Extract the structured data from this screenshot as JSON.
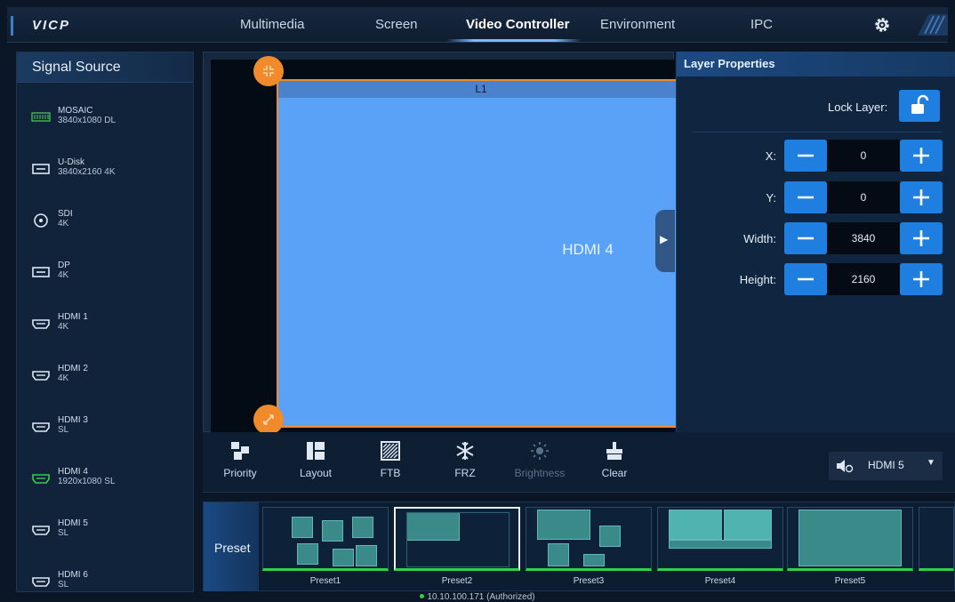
{
  "app": {
    "logo": "VICP"
  },
  "nav": {
    "tabs": [
      {
        "label": "Multimedia"
      },
      {
        "label": "Screen"
      },
      {
        "label": "Video Controller",
        "active": true
      },
      {
        "label": "Environment"
      },
      {
        "label": "IPC"
      }
    ]
  },
  "signal_source": {
    "title": "Signal Source",
    "items": [
      {
        "name": "MOSAIC",
        "res": "3840x1080 DL",
        "icon": "mosaic-icon",
        "active": false
      },
      {
        "name": "U-Disk",
        "res": "3840x2160 4K",
        "icon": "usb-disk-icon",
        "active": false
      },
      {
        "name": "SDI",
        "res": "4K",
        "icon": "sdi-icon",
        "active": false
      },
      {
        "name": "DP",
        "res": "4K",
        "icon": "displayport-icon",
        "active": false
      },
      {
        "name": "HDMI 1",
        "res": "4K",
        "icon": "hdmi-icon",
        "active": false
      },
      {
        "name": "HDMI 2",
        "res": "4K",
        "icon": "hdmi-icon",
        "active": false
      },
      {
        "name": "HDMI 3",
        "res": "SL",
        "icon": "hdmi-icon",
        "active": false
      },
      {
        "name": "HDMI 4",
        "res": "1920x1080 SL",
        "icon": "hdmi-icon",
        "active": true
      },
      {
        "name": "HDMI 5",
        "res": "SL",
        "icon": "hdmi-icon",
        "active": false
      },
      {
        "name": "HDMI 6",
        "res": "SL",
        "icon": "hdmi-icon",
        "active": false
      }
    ]
  },
  "canvas": {
    "layer_header": "L1",
    "layer_source": "HDMI 4"
  },
  "layer_properties": {
    "title": "Layer Properties",
    "lock_label": "Lock Layer:",
    "fields": [
      {
        "label": "X:",
        "value": "0"
      },
      {
        "label": "Y:",
        "value": "0"
      },
      {
        "label": "Width:",
        "value": "3840"
      },
      {
        "label": "Height:",
        "value": "2160"
      }
    ]
  },
  "toolbar": {
    "tools": [
      {
        "label": "Priority",
        "icon": "priority-icon",
        "enabled": true
      },
      {
        "label": "Layout",
        "icon": "layout-icon",
        "enabled": true
      },
      {
        "label": "FTB",
        "icon": "ftb-icon",
        "enabled": true
      },
      {
        "label": "FRZ",
        "icon": "freeze-icon",
        "enabled": true
      },
      {
        "label": "Brightness",
        "icon": "brightness-icon",
        "enabled": false
      },
      {
        "label": "Clear",
        "icon": "clear-icon",
        "enabled": true
      }
    ],
    "audio_source": "HDMI 5"
  },
  "presets": {
    "label": "Preset",
    "items": [
      {
        "name": "Preset1",
        "selected": false
      },
      {
        "name": "Preset2",
        "selected": true
      },
      {
        "name": "Preset3",
        "selected": false
      },
      {
        "name": "Preset4",
        "selected": false
      },
      {
        "name": "Preset5",
        "selected": false
      }
    ]
  },
  "status": {
    "text": "10.10.100.171 (Authorized)"
  },
  "colors": {
    "accent": "#1f7fe0",
    "layer_fill": "#5aa2f8",
    "handle": "#f08a2a",
    "preset_active": "#2fd14a",
    "active_source": "#2fd14a"
  }
}
